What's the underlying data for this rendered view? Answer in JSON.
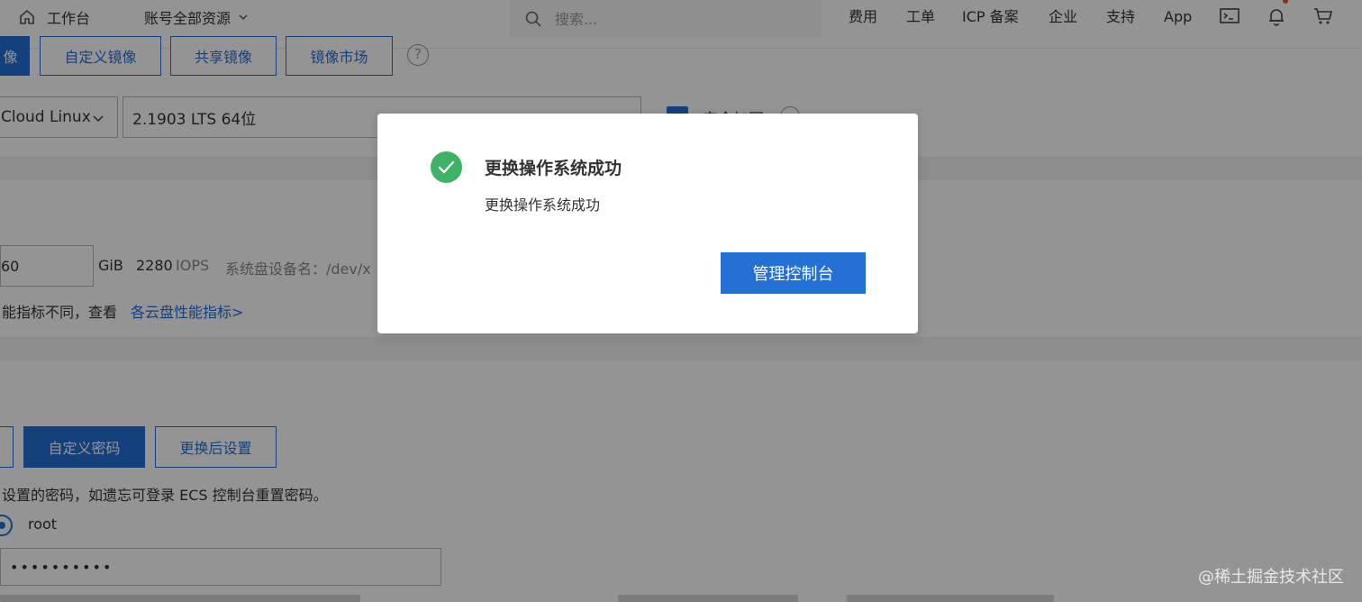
{
  "topbar": {
    "home_label": "工作台",
    "account_label": "账号全部资源",
    "search_placeholder": "搜索...",
    "nav": [
      "费用",
      "工单",
      "ICP 备案",
      "企业",
      "支持",
      "App"
    ],
    "icons": [
      "terminal-icon",
      "bell-icon",
      "cart-icon"
    ],
    "notification_color": "#e05a2b"
  },
  "image_tabs": {
    "active_partial": "像",
    "custom": "自定义镜像",
    "shared": "共享镜像",
    "market": "镜像市场",
    "help": "?"
  },
  "os": {
    "distro": "Cloud Linux",
    "version": "2.1903 LTS 64位",
    "checkbox_label": "安全加固"
  },
  "disk": {
    "size": "60",
    "unit": "GiB",
    "iops_value": "2280",
    "iops_unit": "IOPS",
    "device_label": "系统盘设备名：/dev/x",
    "perf_note": "能指标不同，查看",
    "perf_link": "各云盘性能指标>"
  },
  "password": {
    "left_partial_button": "",
    "custom_button": "自定义密码",
    "after_button": "更换后设置",
    "hint": "设置的密码，如遗忘可登录 ECS 控制台重置密码。",
    "user": "root",
    "masked_value": "••••••••••"
  },
  "modal": {
    "title": "更换操作系统成功",
    "message": "更换操作系统成功",
    "primary_button": "管理控制台",
    "success_color": "#3eb266",
    "accent": "#2470d5"
  },
  "watermark": "@稀土掘金技术社区"
}
